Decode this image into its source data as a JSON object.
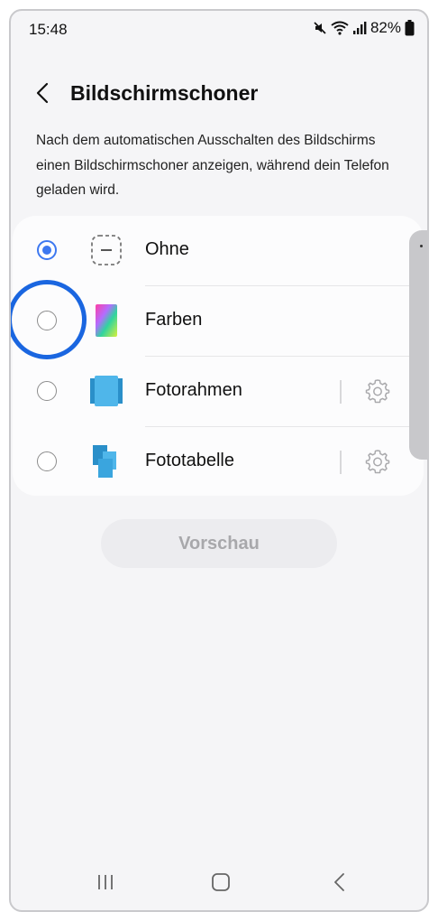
{
  "status_bar": {
    "time": "15:48",
    "battery": "82%",
    "icons": [
      "mute-icon",
      "wifi-icon",
      "signal-icon",
      "battery-icon"
    ]
  },
  "header": {
    "title": "Bildschirmschoner",
    "back_icon": "back-arrow-icon"
  },
  "description": "Nach dem automatischen Ausschalten des Bildschirms einen Bildschirmschoner anzeigen, während dein Telefon geladen wird.",
  "options": [
    {
      "label": "Ohne",
      "selected": true,
      "icon": "none-icon",
      "has_settings": false
    },
    {
      "label": "Farben",
      "selected": false,
      "icon": "colors-icon",
      "has_settings": false
    },
    {
      "label": "Fotorahmen",
      "selected": false,
      "icon": "photo-frame-icon",
      "has_settings": true
    },
    {
      "label": "Fototabelle",
      "selected": false,
      "icon": "photo-table-icon",
      "has_settings": true
    }
  ],
  "preview_button": {
    "label": "Vorschau",
    "enabled": false
  },
  "nav_bar": {
    "icons": [
      "recents-icon",
      "home-icon",
      "back-icon"
    ]
  },
  "colors": {
    "accent": "#3d78f0",
    "highlight_ring": "#1a66e0",
    "background": "#f5f5f7"
  }
}
